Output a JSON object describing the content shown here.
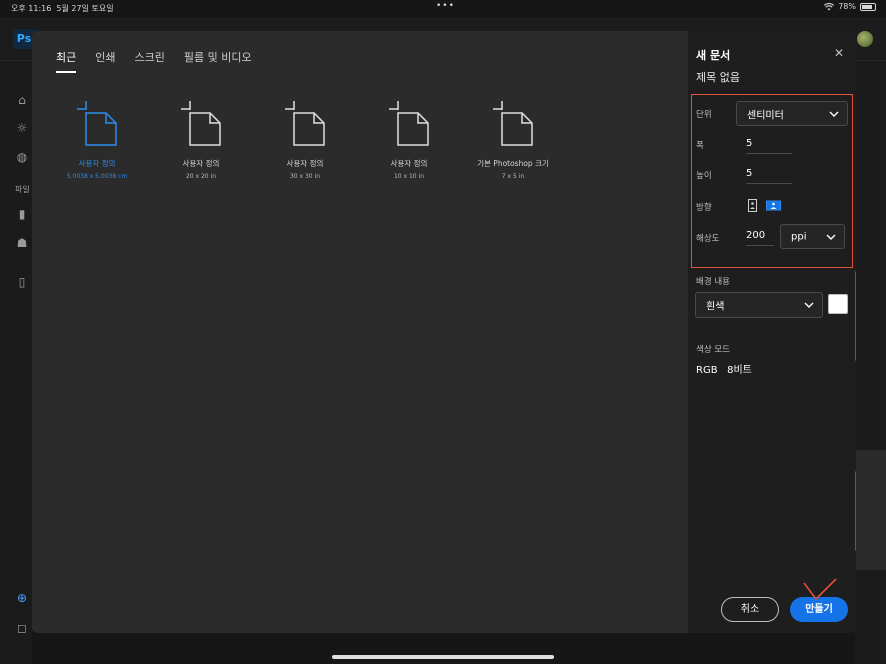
{
  "status_bar": {
    "time": "오후 11:16",
    "date": "5월 27일 토요일",
    "dots": "•••",
    "battery_percent": "78%"
  },
  "background_app": {
    "logo": "Ps",
    "sidebar_section_label": "파일"
  },
  "tabs": [
    {
      "label": "최근",
      "active": true
    },
    {
      "label": "인쇄",
      "active": false
    },
    {
      "label": "스크린",
      "active": false
    },
    {
      "label": "필름 및 비디오",
      "active": false
    }
  ],
  "presets": [
    {
      "name": "사용자 정의",
      "size": "5.0038 x 5.0038 cm",
      "selected": true
    },
    {
      "name": "사용자 정의",
      "size": "20 x 20 in",
      "selected": false
    },
    {
      "name": "사용자 정의",
      "size": "30 x 30 in",
      "selected": false
    },
    {
      "name": "사용자 정의",
      "size": "10 x 10 in",
      "selected": false
    },
    {
      "name": "기본 Photoshop 크기",
      "size": "7 x 5 in",
      "selected": false
    }
  ],
  "panel": {
    "title": "새 문서",
    "document_name": "제목 없음",
    "unit_label": "단위",
    "unit_value": "센티미터",
    "width_label": "폭",
    "width_value": "5",
    "height_label": "높이",
    "height_value": "5",
    "orientation_label": "방향",
    "orientation_selected": "landscape",
    "resolution_label": "해상도",
    "resolution_value": "200",
    "resolution_unit": "ppi",
    "background_label": "배경 내용",
    "background_value": "흰색",
    "background_color": "#ffffff",
    "color_mode_label": "색상 모드",
    "color_mode_value": "RGB   8비트",
    "cancel_label": "취소",
    "create_label": "만들기"
  },
  "colors": {
    "accent": "#1473e6",
    "selected_preset": "#2d8ceb",
    "annotation": "#e0503a"
  }
}
